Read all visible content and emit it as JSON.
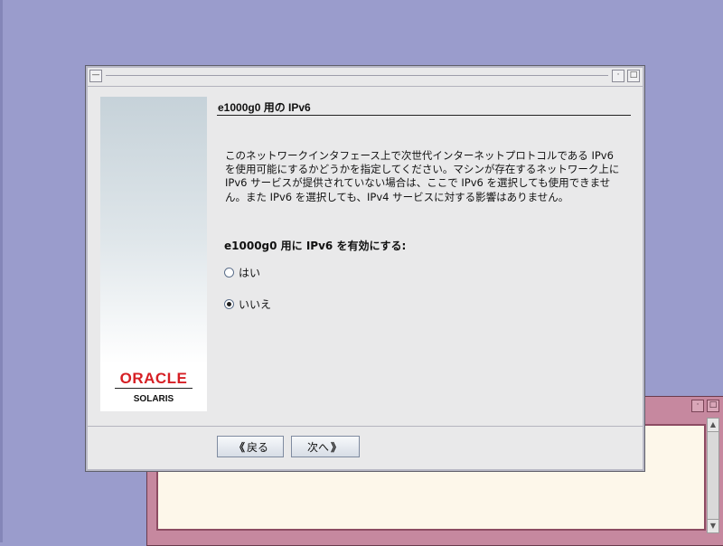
{
  "dialog": {
    "title": "e1000g0 用の IPv6",
    "description": "このネットワークインタフェース上で次世代インターネットプロトコルである IPv6 を使用可能にするかどうかを指定してください。マシンが存在するネットワーク上に IPv6 サービスが提供されていない場合は、ここで IPv6 を選択しても使用できません。また IPv6 を選択しても、IPv4 サービスに対する影響はありません。",
    "question": "e1000g0 用に IPv6 を有効にする:",
    "options": [
      {
        "label": "はい",
        "selected": false
      },
      {
        "label": "いいえ",
        "selected": true
      }
    ],
    "back_button": {
      "icon": "《",
      "label": "戻る"
    },
    "next_button": {
      "label": "次へ",
      "icon": "》"
    },
    "titlebar": {
      "menu_glyph": "—",
      "minimize_glyph": "·",
      "maximize_glyph": "□"
    }
  },
  "sidebar": {
    "logo_text": "ORACLE",
    "product": "SOLARIS",
    "logo_color": "#d61f24"
  },
  "background_window": {
    "minimize_glyph": "·",
    "maximize_glyph": "□",
    "scroll_up": "▲",
    "scroll_down": "▼"
  }
}
